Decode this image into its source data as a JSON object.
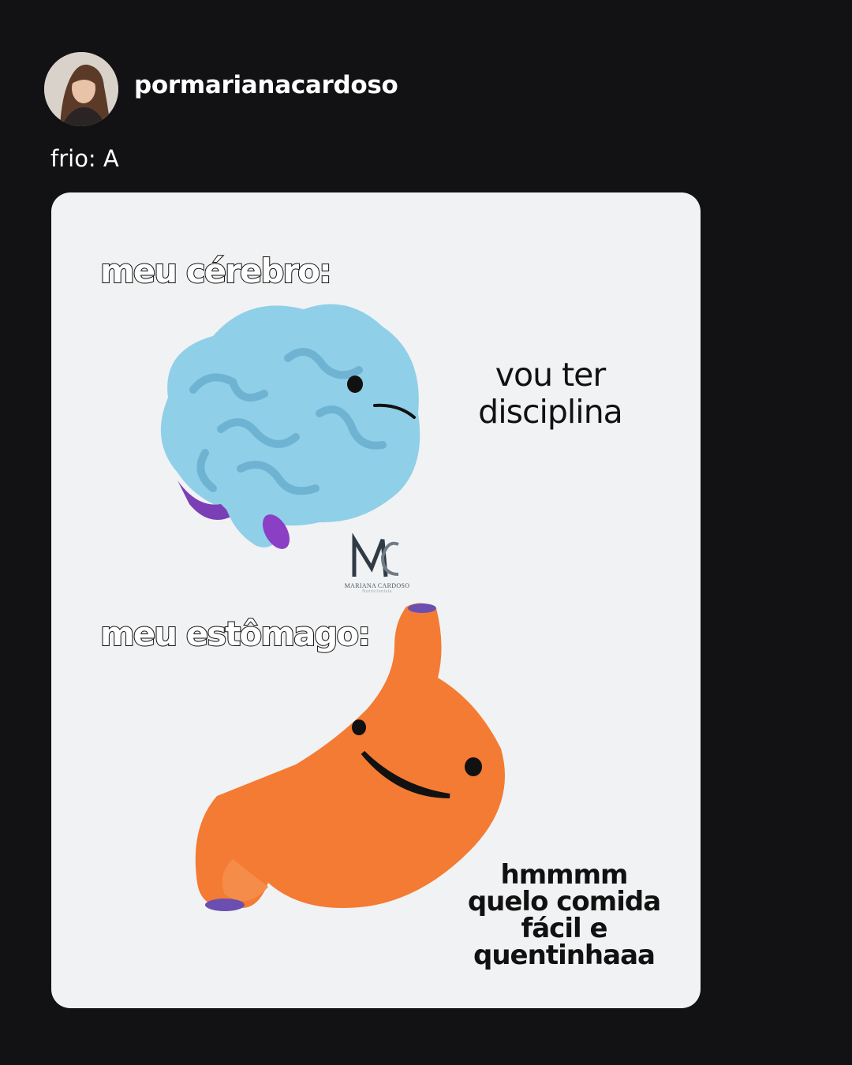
{
  "post": {
    "username": "pormarianacardoso",
    "caption": "frio: A"
  },
  "meme": {
    "brain_label": "meu cérebro:",
    "brain_reply_line1": "vou ter",
    "brain_reply_line2": "disciplina",
    "stomach_label": "meu estômago:",
    "stomach_reply_line1": "hmmmm",
    "stomach_reply_line2": "quelo comida",
    "stomach_reply_line3": "fácil e",
    "stomach_reply_line4": "quentinhaaa",
    "watermark_name": "MARIANA CARDOSO",
    "watermark_subtitle": "Nutricionista",
    "watermark_monogram": "MC"
  },
  "colors": {
    "background": "#121214",
    "card": "#f1f2f4",
    "brain": "#8fcfe8",
    "stomach": "#f47b33"
  }
}
